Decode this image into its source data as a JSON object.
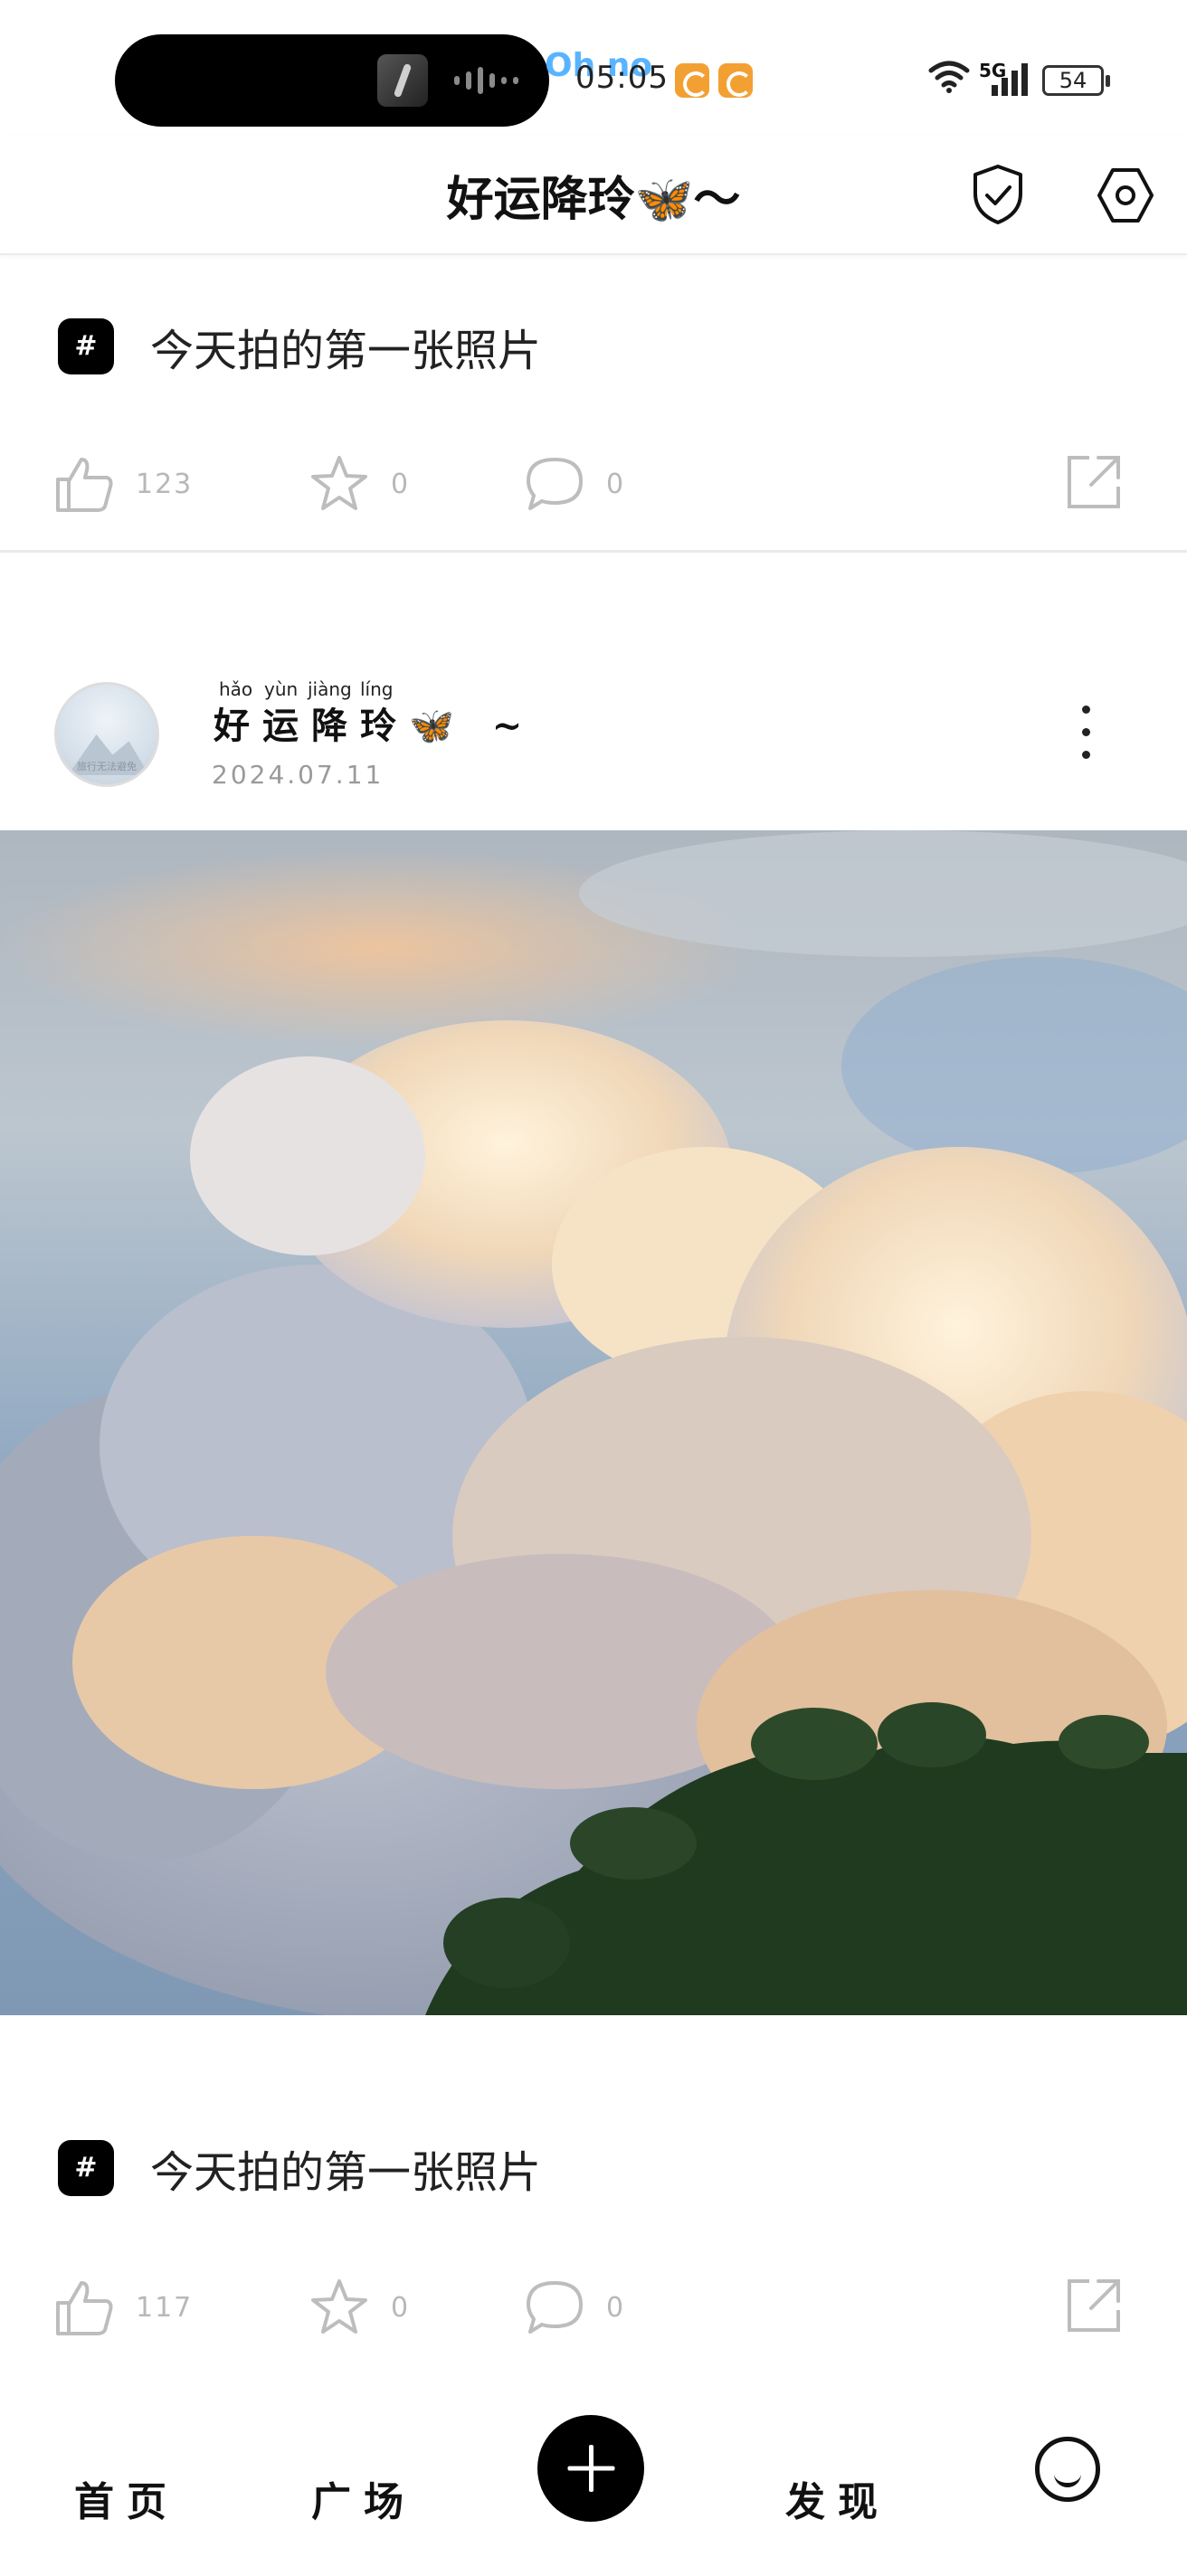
{
  "status_bar": {
    "time": "05:05",
    "overlay_text": "Oh no",
    "network": "5G",
    "battery": "54"
  },
  "header": {
    "title": "好运降玲🦋～",
    "icons": [
      "shield-check-icon",
      "settings-hexagon-icon"
    ]
  },
  "posts": [
    {
      "topic_badge": "#",
      "topic": "今天拍的第一张照片",
      "likes": "123",
      "favorites": "0",
      "comments": "0"
    },
    {
      "author": {
        "pinyin": [
          "hǎo",
          "yùn",
          "jiàng",
          "líng"
        ],
        "name": "好运降玲🦋 ~",
        "avatar_text": "旅行无法避免",
        "date": "2024.07.11"
      },
      "topic_badge": "#",
      "topic": "今天拍的第一张照片",
      "likes": "117",
      "favorites": "0",
      "comments": "0"
    }
  ],
  "bottom_nav": {
    "home": "首页",
    "square": "广场",
    "discover": "发现"
  },
  "colors": {
    "accent": "#000000",
    "muted": "#b8b8b8",
    "badge_orange": "#f3a033"
  }
}
